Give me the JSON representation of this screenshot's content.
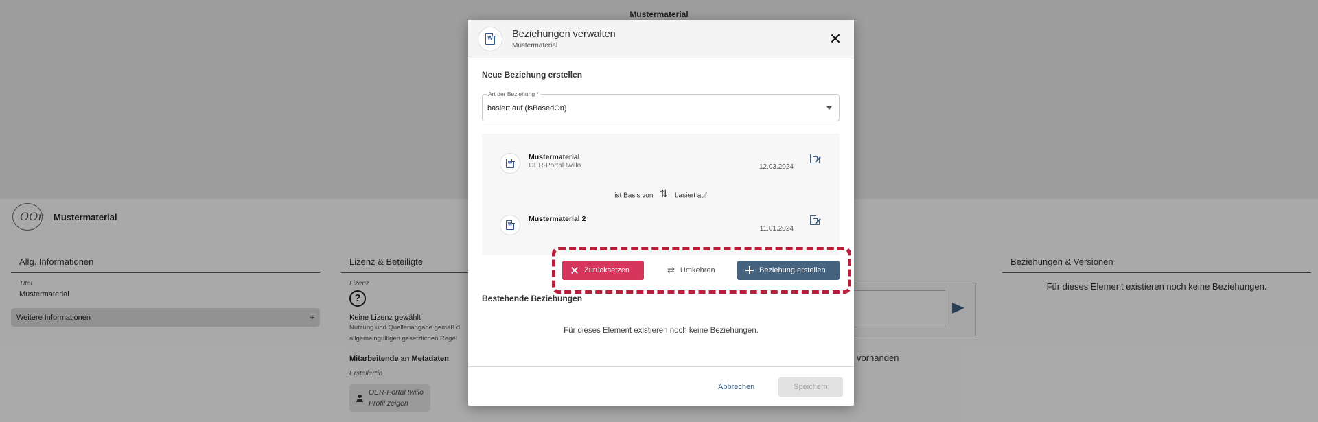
{
  "background": {
    "top_title": "Mustermaterial",
    "page_title": "Mustermaterial",
    "logo_text": "OOr",
    "general": {
      "heading": "Allg. Informationen",
      "title_label": "Titel",
      "title_value": "Mustermaterial",
      "more_info_label": "Weitere Informationen",
      "more_info_plus": "+"
    },
    "license": {
      "heading": "Lizenz & Beteiligte",
      "license_label": "Lizenz",
      "question_glyph": "?",
      "no_license": "Keine Lizenz gewählt",
      "license_text_1": "Nutzung und Quellenangabe gemäß d",
      "license_text_2": "allgemeingültigen gesetzlichen Regel",
      "contributors_title": "Mitarbeitende an Metadaten",
      "creator_label": "Ersteller*in",
      "profile_name": "OER-Portal twillo",
      "profile_link": "Profil zeigen"
    },
    "comments": {
      "vorhanden_text": "vorhanden"
    },
    "relations": {
      "heading": "Beziehungen & Versionen",
      "empty_text": "Für dieses Element existieren noch keine Beziehungen."
    }
  },
  "modal": {
    "title": "Beziehungen verwalten",
    "subtitle": "Mustermaterial",
    "doc_glyph": "W",
    "new_relation_title": "Neue Beziehung erstellen",
    "relation_type_label": "Art der Beziehung *",
    "relation_type_value": "basiert auf (isBasedOn)",
    "source": {
      "name": "Mustermaterial",
      "publisher": "OER-Portal twillo",
      "date": "12.03.2024"
    },
    "direction": {
      "left": "ist Basis von",
      "right": "basiert auf"
    },
    "target": {
      "name": "Mustermaterial 2",
      "date": "11.01.2024"
    },
    "buttons": {
      "reset": "Zurücksetzen",
      "swap": "Umkehren",
      "create": "Beziehung erstellen",
      "cancel": "Abbrechen",
      "save": "Speichern"
    },
    "existing_title": "Bestehende Beziehungen",
    "existing_empty": "Für dieses Element existieren noch keine Beziehungen."
  },
  "colors": {
    "highlight_border": "#b51f3a",
    "reset_button": "#d6365b",
    "primary_button": "#45627f",
    "word_icon": "#2b5797"
  },
  "icons": [
    "word-document-icon",
    "close-icon",
    "chevron-down-icon",
    "open-external-icon",
    "swap-vertical-icon",
    "x-icon",
    "swap-horizontal-icon",
    "plus-icon",
    "send-icon",
    "question-icon",
    "person-icon"
  ]
}
